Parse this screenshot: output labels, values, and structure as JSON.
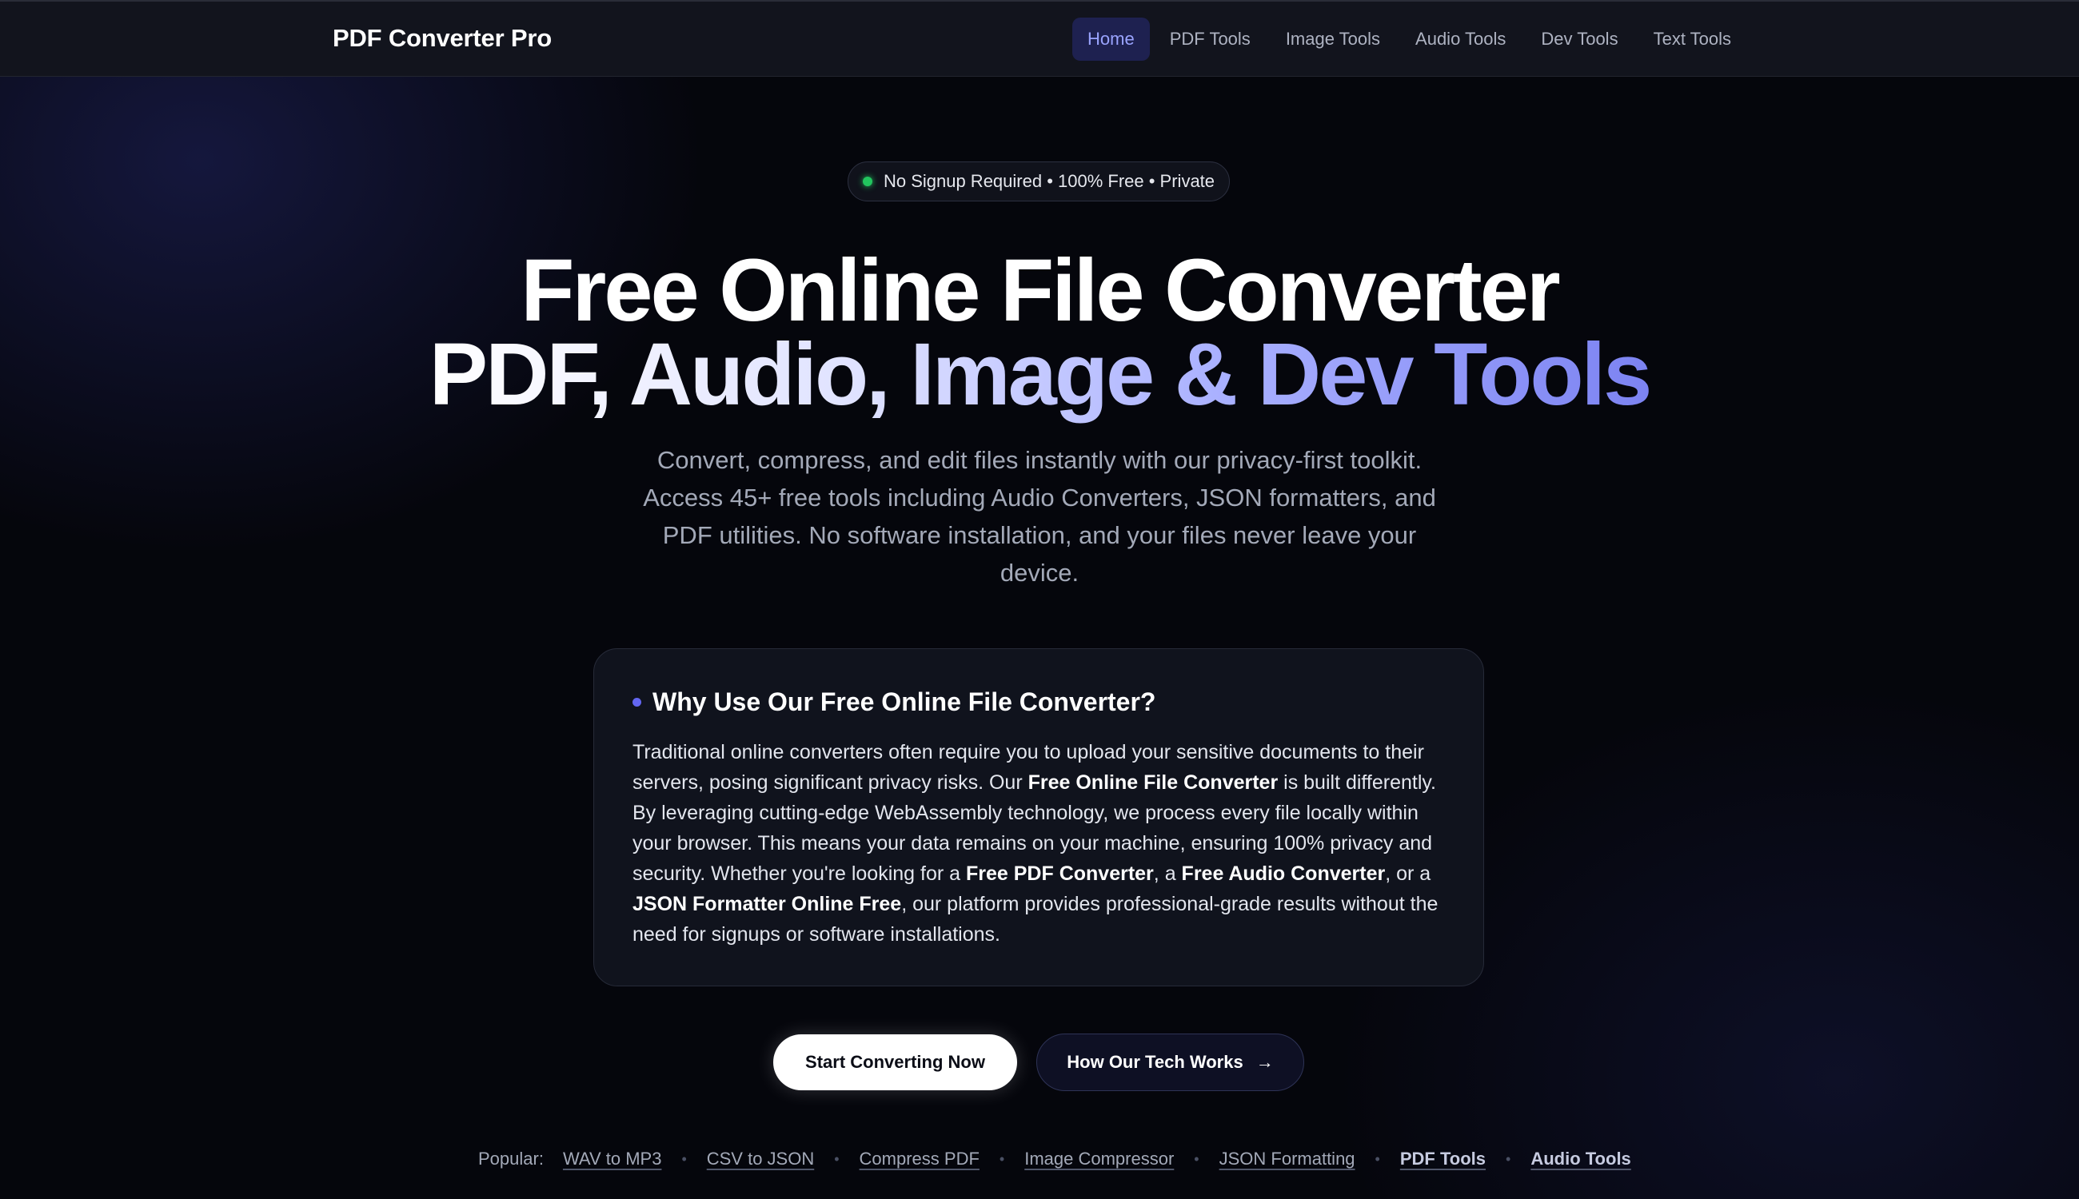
{
  "nav": {
    "brand": "PDF Converter Pro",
    "links": [
      "Home",
      "PDF Tools",
      "Image Tools",
      "Audio Tools",
      "Dev Tools",
      "Text Tools"
    ],
    "active_index": 0
  },
  "hero": {
    "badge": "No Signup Required • 100% Free • Private",
    "headline_line1": "Free Online File Converter",
    "headline_line2": "PDF, Audio, Image & Dev Tools",
    "subtext": "Convert, compress, and edit files instantly with our privacy-first toolkit. Access 45+ free tools including Audio Converters, JSON formatters, and PDF utilities. No software installation, and your files never leave your device."
  },
  "card": {
    "title": "Why Use Our Free Online File Converter?",
    "p1": "Traditional online converters often require you to upload your sensitive documents to their servers, posing significant privacy risks. Our ",
    "b1": "Free Online File Converter",
    "p2": " is built differently. By leveraging cutting-edge WebAssembly technology, we process every file locally within your browser. This means your data remains on your machine, ensuring 100% privacy and security. Whether you're looking for a ",
    "b2": "Free PDF Converter",
    "p3": ", a ",
    "b3": "Free Audio Converter",
    "p4": ", or a ",
    "b4": "JSON Formatter Online Free",
    "p5": ", our platform provides professional-grade results without the need for signups or software installations."
  },
  "cta": {
    "primary": "Start Converting Now",
    "secondary": "How Our Tech Works",
    "secondary_icon": "arrow-right-icon"
  },
  "popular": {
    "label": "Popular:",
    "links": [
      "WAV to MP3",
      "CSV to JSON",
      "Compress PDF",
      "Image Compressor",
      "JSON Formatting",
      "PDF Tools",
      "Audio Tools"
    ]
  },
  "colors": {
    "accent": "#6366f1",
    "active_nav_bg": "#1e2150",
    "status_dot": "#22c55e"
  }
}
